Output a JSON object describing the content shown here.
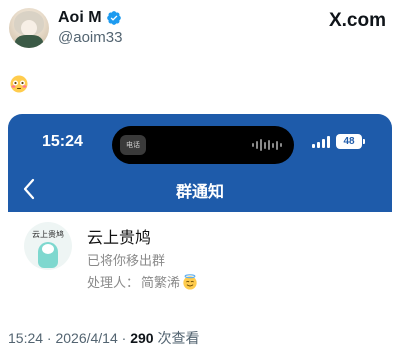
{
  "author": {
    "name": "Aoi M",
    "handle": "@aoim33"
  },
  "brand": "X.com",
  "tweet_emoji": "flushed-face-emoji",
  "screenshot": {
    "status_time": "15:24",
    "battery": "48",
    "island_label": "电话",
    "nav_title": "群通知",
    "nav_color": "#1e5baa",
    "notification": {
      "group_avatar_text": "云上贵鸠",
      "group_name": "云上贵鸠",
      "message": "已将你移出群",
      "handler_label": "处理人：",
      "handler_name": "简繁浠"
    }
  },
  "footer": {
    "timestamp": "15:24 · 2026/4/14 · ",
    "views_count": "290",
    "views_label": " 次查看"
  }
}
